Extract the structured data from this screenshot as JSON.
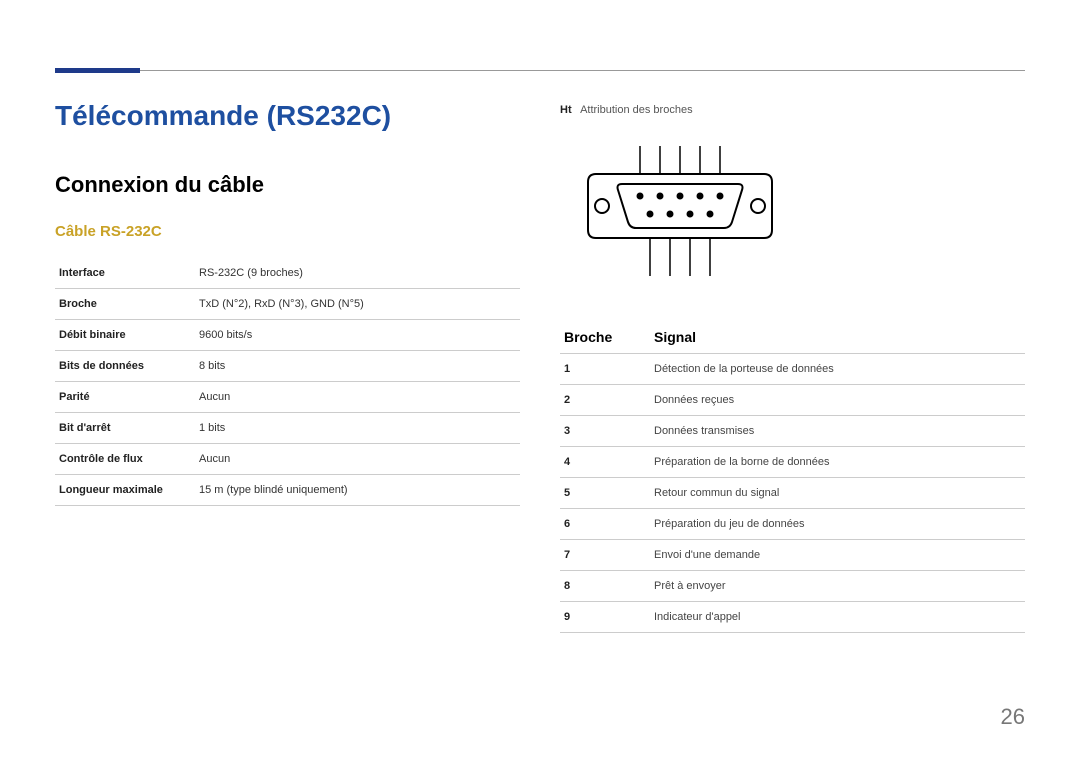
{
  "header": {
    "title": "Télécommande (RS232C)",
    "section_title": "Connexion du câble",
    "sub_title": "Câble RS-232C"
  },
  "spec_table": [
    {
      "label": "Interface",
      "value": "RS-232C (9 broches)"
    },
    {
      "label": "Broche",
      "value": "TxD (N°2), RxD (N°3), GND (N°5)"
    },
    {
      "label": "Débit binaire",
      "value": "9600 bits/s"
    },
    {
      "label": "Bits de données",
      "value": "8 bits"
    },
    {
      "label": "Parité",
      "value": "Aucun"
    },
    {
      "label": "Bit d'arrêt",
      "value": "1 bits"
    },
    {
      "label": "Contrôle de flux",
      "value": "Aucun"
    },
    {
      "label": "Longueur maximale",
      "value": "15 m (type blindé uniquement)"
    }
  ],
  "right_col": {
    "caption_label": "Ht",
    "caption_text": "Attribution des broches",
    "pin_header": {
      "col1": "Broche",
      "col2": "Signal"
    }
  },
  "pin_table": [
    {
      "pin": "1",
      "signal": "Détection de la porteuse de données"
    },
    {
      "pin": "2",
      "signal": "Données reçues"
    },
    {
      "pin": "3",
      "signal": "Données transmises"
    },
    {
      "pin": "4",
      "signal": "Préparation de la borne de données"
    },
    {
      "pin": "5",
      "signal": "Retour commun du signal"
    },
    {
      "pin": "6",
      "signal": "Préparation du jeu de données"
    },
    {
      "pin": "7",
      "signal": "Envoi d'une demande"
    },
    {
      "pin": "8",
      "signal": "Prêt à envoyer"
    },
    {
      "pin": "9",
      "signal": "Indicateur d'appel"
    }
  ],
  "page_number": "26"
}
